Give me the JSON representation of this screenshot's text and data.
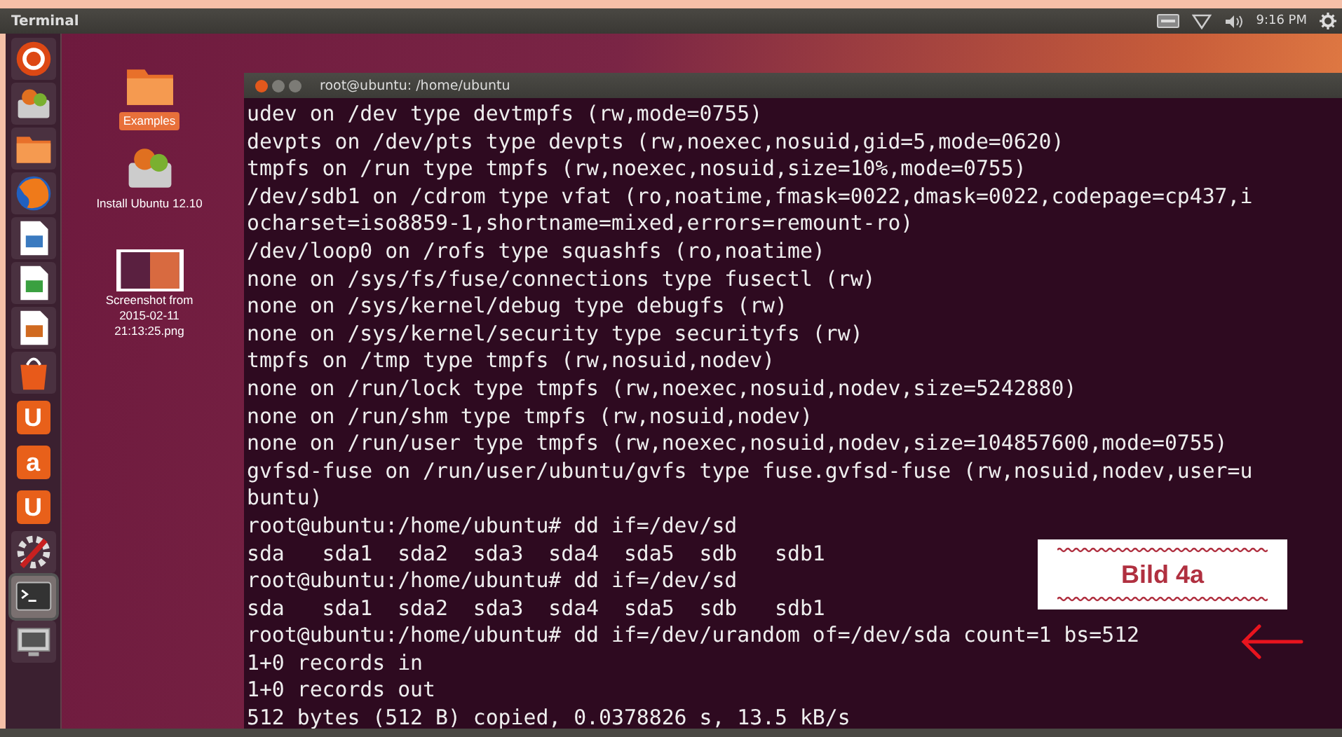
{
  "top_panel": {
    "app_title": "Terminal",
    "clock": "9:16 PM"
  },
  "launcher": [
    {
      "kind": "ubuntu",
      "selected": false
    },
    {
      "kind": "installer",
      "selected": false
    },
    {
      "kind": "folder",
      "selected": false
    },
    {
      "kind": "browser",
      "selected": false
    },
    {
      "kind": "document",
      "selected": false
    },
    {
      "kind": "spreadsheet",
      "selected": false
    },
    {
      "kind": "presentation",
      "selected": false
    },
    {
      "kind": "bag",
      "selected": false
    },
    {
      "kind": "letter",
      "glyph": "U",
      "selected": false
    },
    {
      "kind": "letter",
      "glyph": "a",
      "selected": false
    },
    {
      "kind": "letter",
      "glyph": "U",
      "selected": false
    },
    {
      "kind": "settings",
      "selected": false
    },
    {
      "kind": "terminal",
      "selected": true
    },
    {
      "kind": "monitor",
      "selected": false
    }
  ],
  "desktop_icons": [
    {
      "kind": "folder",
      "label": "Examples",
      "selected": true
    },
    {
      "kind": "installer",
      "label": "Install Ubuntu 12.10",
      "selected": false
    },
    {
      "kind": "screenshot",
      "label": "Screenshot from 2015-02-11 21:13:25.png",
      "selected": false
    }
  ],
  "terminal": {
    "title": "root@ubuntu: /home/ubuntu",
    "lines": [
      "udev on /dev type devtmpfs (rw,mode=0755)",
      "devpts on /dev/pts type devpts (rw,noexec,nosuid,gid=5,mode=0620)",
      "tmpfs on /run type tmpfs (rw,noexec,nosuid,size=10%,mode=0755)",
      "/dev/sdb1 on /cdrom type vfat (ro,noatime,fmask=0022,dmask=0022,codepage=cp437,i",
      "ocharset=iso8859-1,shortname=mixed,errors=remount-ro)",
      "/dev/loop0 on /rofs type squashfs (ro,noatime)",
      "none on /sys/fs/fuse/connections type fusectl (rw)",
      "none on /sys/kernel/debug type debugfs (rw)",
      "none on /sys/kernel/security type securityfs (rw)",
      "tmpfs on /tmp type tmpfs (rw,nosuid,nodev)",
      "none on /run/lock type tmpfs (rw,noexec,nosuid,nodev,size=5242880)",
      "none on /run/shm type tmpfs (rw,nosuid,nodev)",
      "none on /run/user type tmpfs (rw,noexec,nosuid,nodev,size=104857600,mode=0755)",
      "gvfsd-fuse on /run/user/ubuntu/gvfs type fuse.gvfsd-fuse (rw,nosuid,nodev,user=u",
      "buntu)",
      "root@ubuntu:/home/ubuntu# dd if=/dev/sd",
      "sda   sda1  sda2  sda3  sda4  sda5  sdb   sdb1",
      "root@ubuntu:/home/ubuntu# dd if=/dev/sd",
      "sda   sda1  sda2  sda3  sda4  sda5  sdb   sdb1",
      "root@ubuntu:/home/ubuntu# dd if=/dev/urandom of=/dev/sda count=1 bs=512",
      "1+0 records in",
      "1+0 records out",
      "512 bytes (512 B) copied, 0.0378826 s, 13.5 kB/s"
    ]
  },
  "annotation": {
    "label": "Bild 4a"
  }
}
